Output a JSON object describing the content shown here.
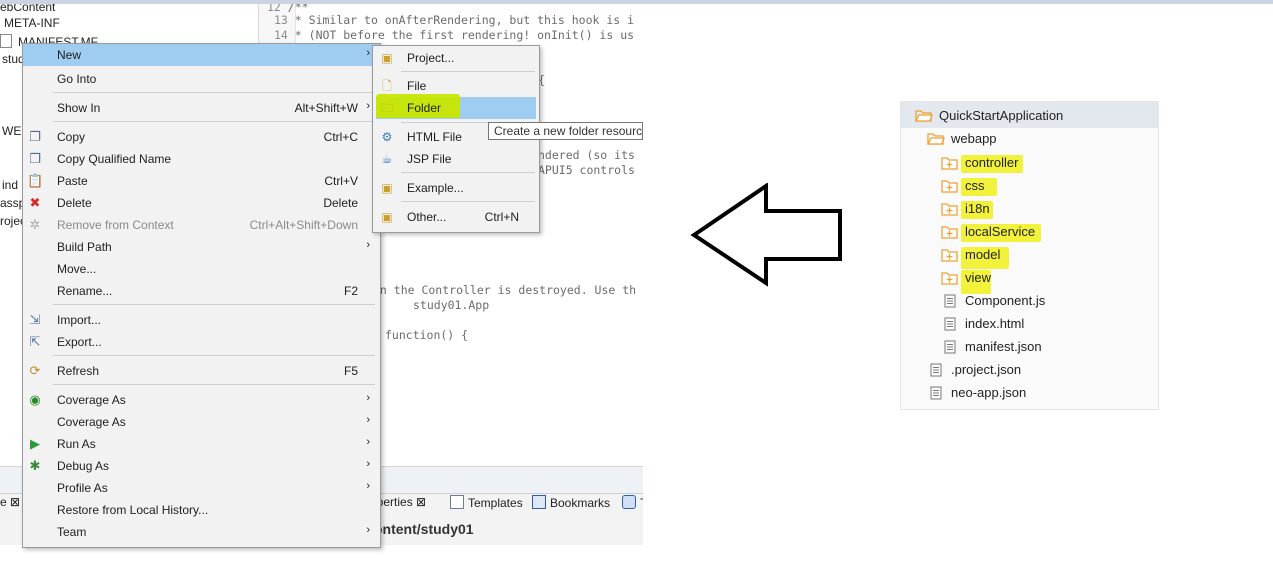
{
  "explorer": {
    "rows": [
      "ebContent",
      "META-INF",
      "MANIFEST.MF",
      "stud",
      "",
      "",
      "",
      "WE",
      "",
      "",
      "ind",
      "assp",
      "rojec"
    ]
  },
  "editor": {
    "lines": [
      {
        "num": "12",
        "text": "/**"
      },
      {
        "num": "13",
        "text": "* Similar to onAfterRendering, but this hook is i"
      },
      {
        "num": "14",
        "text": "* (NOT before the first rendering! onInit() is us"
      }
    ],
    "fragments": [
      "{",
      "ndered (so its",
      "APUI5 controls",
      "en the Controller is destroyed. Use th",
      "study01.App",
      "function() {"
    ]
  },
  "bottom_panel": {
    "tabs": [
      "e",
      "operties",
      "Templates",
      "Bookmarks",
      "T"
    ],
    "path": "ontent/study01"
  },
  "context_menu": {
    "items": [
      {
        "label": "New",
        "shortcut": "",
        "submenu": true,
        "highlighted": true
      },
      {
        "label": "Go Into",
        "shortcut": ""
      },
      {
        "label": "Show In",
        "shortcut": "Alt+Shift+W",
        "submenu": true
      },
      {
        "label": "Copy",
        "shortcut": "Ctrl+C"
      },
      {
        "label": "Copy Qualified Name",
        "shortcut": ""
      },
      {
        "label": "Paste",
        "shortcut": "Ctrl+V"
      },
      {
        "label": "Delete",
        "shortcut": "Delete"
      },
      {
        "label": "Remove from Context",
        "shortcut": "Ctrl+Alt+Shift+Down",
        "disabled": true
      },
      {
        "label": "Build Path",
        "shortcut": "",
        "submenu": true
      },
      {
        "label": "Move...",
        "shortcut": ""
      },
      {
        "label": "Rename...",
        "shortcut": "F2"
      },
      {
        "label": "Import...",
        "shortcut": ""
      },
      {
        "label": "Export...",
        "shortcut": ""
      },
      {
        "label": "Refresh",
        "shortcut": "F5"
      },
      {
        "label": "Coverage As",
        "shortcut": "",
        "submenu": true
      },
      {
        "label": "Coverage As",
        "shortcut": "",
        "submenu": true
      },
      {
        "label": "Run As",
        "shortcut": "",
        "submenu": true
      },
      {
        "label": "Debug As",
        "shortcut": "",
        "submenu": true
      },
      {
        "label": "Profile As",
        "shortcut": "",
        "submenu": true
      },
      {
        "label": "Restore from Local History...",
        "shortcut": ""
      },
      {
        "label": "Team",
        "shortcut": "",
        "submenu": true
      }
    ]
  },
  "new_submenu": {
    "items": [
      {
        "label": "Project...",
        "shortcut": ""
      },
      {
        "label": "File",
        "shortcut": ""
      },
      {
        "label": "Folder",
        "shortcut": "",
        "highlighted": true
      },
      {
        "label": "HTML File",
        "shortcut": ""
      },
      {
        "label": "JSP File",
        "shortcut": ""
      },
      {
        "label": "Example...",
        "shortcut": ""
      },
      {
        "label": "Other...",
        "shortcut": "Ctrl+N"
      }
    ]
  },
  "tooltip": "Create a new folder resource",
  "project_tree": {
    "root": "QuickStartApplication",
    "webapp": "webapp",
    "folders": [
      "controller",
      "css",
      "i18n",
      "localService",
      "model",
      "view"
    ],
    "webapp_files": [
      "Component.js",
      "index.html",
      "manifest.json"
    ],
    "root_files": [
      ".project.json",
      "neo-app.json"
    ]
  },
  "colors": {
    "menu_highlight": "#9fcdf2",
    "marker_green": "#c8e600",
    "marker_yellow": "#f2f23a",
    "folder_orange": "#f0a030"
  }
}
